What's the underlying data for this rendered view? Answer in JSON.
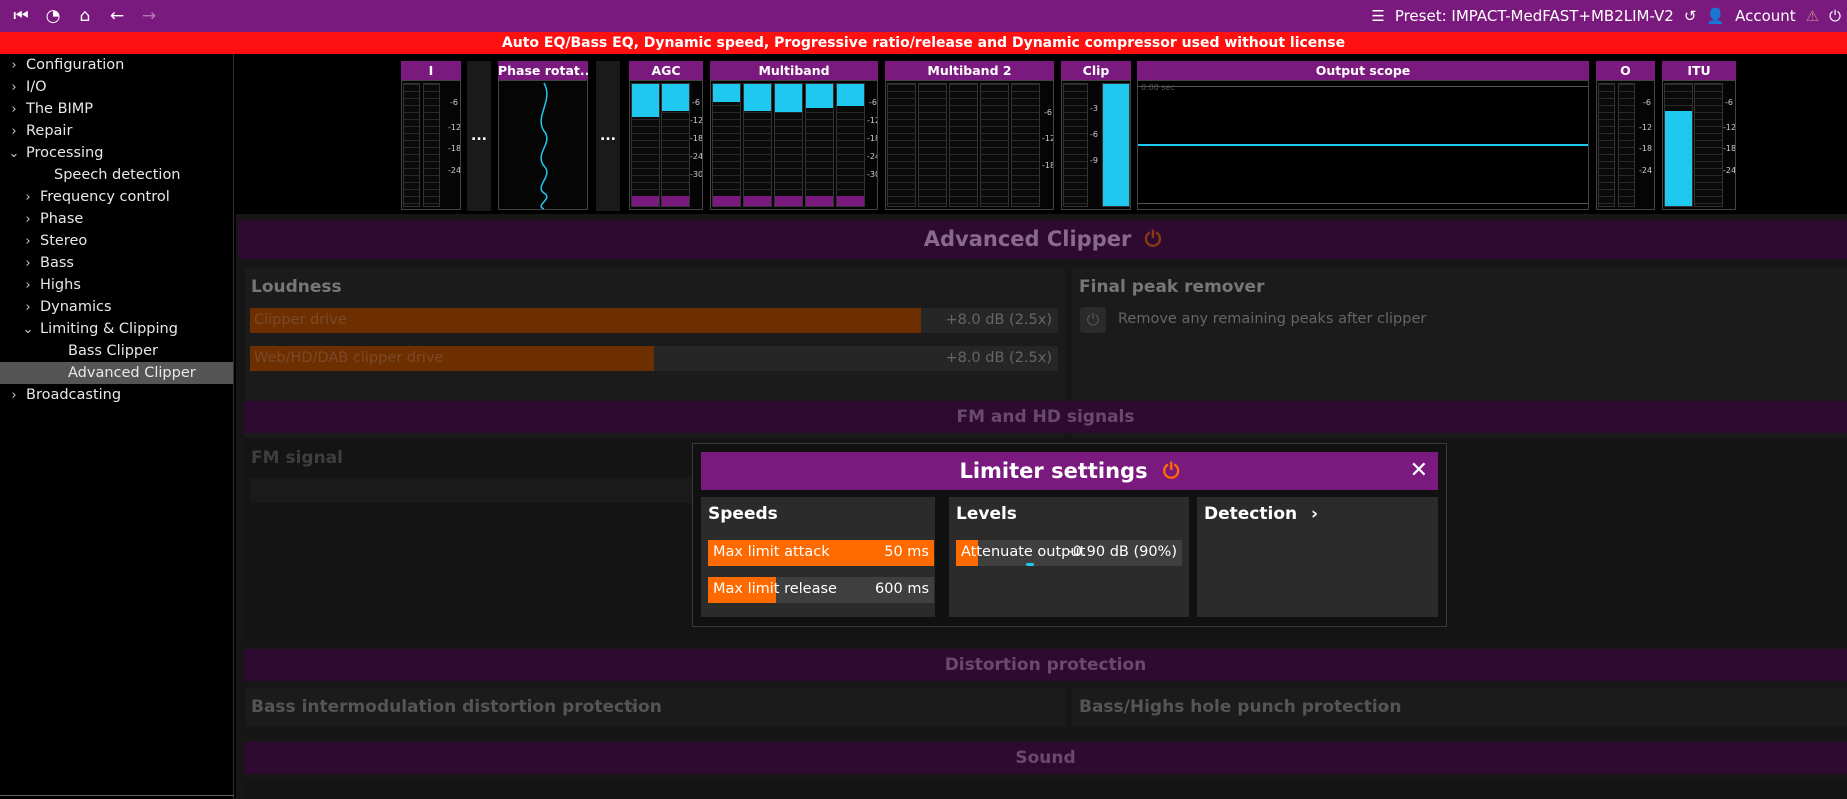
{
  "topbar": {
    "preset_label": "Preset: IMPACT-MedFAST+MB2LIM-V2",
    "account_label": "Account"
  },
  "warning": "Auto EQ/Bass EQ, Dynamic speed, Progressive ratio/release and Dynamic compressor used without license",
  "sidebar": {
    "items": [
      {
        "label": "Configuration",
        "chev": "›"
      },
      {
        "label": "I/O",
        "chev": "›"
      },
      {
        "label": "The BIMP",
        "chev": "›"
      },
      {
        "label": "Repair",
        "chev": "›"
      },
      {
        "label": "Processing",
        "chev": "⌄"
      },
      {
        "label": "Speech detection",
        "chev": ""
      },
      {
        "label": "Frequency control",
        "chev": "›"
      },
      {
        "label": "Phase",
        "chev": "›"
      },
      {
        "label": "Stereo",
        "chev": "›"
      },
      {
        "label": "Bass",
        "chev": "›"
      },
      {
        "label": "Highs",
        "chev": "›"
      },
      {
        "label": "Dynamics",
        "chev": "›"
      },
      {
        "label": "Limiting & Clipping",
        "chev": "⌄"
      },
      {
        "label": "Bass Clipper",
        "chev": ""
      },
      {
        "label": "Advanced Clipper",
        "chev": ""
      },
      {
        "label": "Broadcasting",
        "chev": "›"
      }
    ]
  },
  "meters": {
    "i_label": "I",
    "phase_label": "Phase rotat...",
    "agc_label": "AGC",
    "multiband_label": "Multiband",
    "multiband2_label": "Multiband 2",
    "clip_label": "Clip",
    "scope_label": "Output scope",
    "scope_small": "0.00 sec",
    "o_label": "O",
    "itu_label": "ITU",
    "dots": "...",
    "ticks_a": [
      "-6",
      "-12",
      "-18",
      "-24"
    ],
    "ticks_agc": [
      "-6",
      "-12",
      "-18",
      "-24",
      "-30"
    ],
    "ticks_mb2": [
      "-6",
      "-12",
      "-18"
    ],
    "ticks_clip": [
      "-3",
      "-6",
      "-9"
    ]
  },
  "advanced_clipper": {
    "title": "Advanced Clipper",
    "loudness_title": "Loudness",
    "clipper_drive_label": "Clipper drive",
    "clipper_drive_value": "+8.0 dB (2.5x)",
    "web_drive_label": "Web/HD/DAB clipper drive",
    "web_drive_value": "+8.0 dB (2.5x)",
    "final_peak_title": "Final peak remover",
    "final_peak_text": "Remove any remaining peaks after clipper"
  },
  "fm_hd": {
    "title": "FM and HD signals",
    "fm_signal": "FM signal"
  },
  "distortion": {
    "title": "Distortion protection",
    "bass_imd": "Bass intermodulation distortion protection",
    "hole_punch": "Bass/Highs hole punch protection"
  },
  "sound": {
    "title": "Sound"
  },
  "modal": {
    "title": "Limiter settings",
    "speeds_title": "Speeds",
    "attack_label": "Max limit attack",
    "attack_value": "50 ms",
    "release_label": "Max limit release",
    "release_value": "600 ms",
    "levels_title": "Levels",
    "attenuate_label": "Attenuate output",
    "attenuate_value": "-0.90 dB (90%)",
    "detection_title": "Detection"
  }
}
